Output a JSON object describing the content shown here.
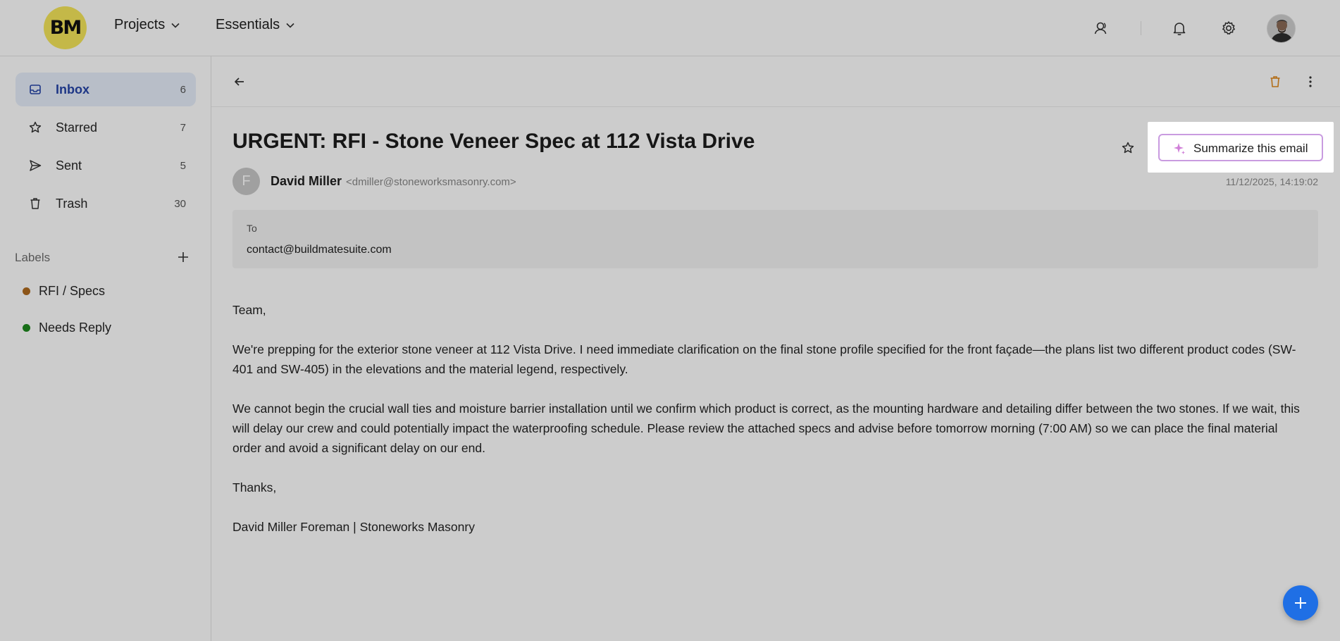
{
  "app": {
    "logo_text": "BM"
  },
  "header": {
    "menus": [
      {
        "label": "Projects"
      },
      {
        "label": "Essentials"
      }
    ],
    "icons": [
      "contacts-icon",
      "bell-icon",
      "gear-icon",
      "avatar"
    ]
  },
  "sidebar": {
    "items": [
      {
        "label": "Inbox",
        "count": "6",
        "icon": "inbox-icon",
        "active": true
      },
      {
        "label": "Starred",
        "count": "7",
        "icon": "star-icon"
      },
      {
        "label": "Sent",
        "count": "5",
        "icon": "send-icon"
      },
      {
        "label": "Trash",
        "count": "30",
        "icon": "trash-icon"
      }
    ],
    "labels_title": "Labels",
    "labels": [
      {
        "label": "RFI / Specs",
        "color": "#b06b1f"
      },
      {
        "label": "Needs Reply",
        "color": "#1e8a1e"
      }
    ]
  },
  "email": {
    "subject": "URGENT: RFI - Stone Veneer Spec at 112 Vista Drive",
    "sender_initial": "F",
    "sender_name": "David Miller",
    "sender_email": "<dmiller@stoneworksmasonry.com>",
    "timestamp": "11/12/2025, 14:19:02",
    "to_label": "To",
    "to_value": "contact@buildmatesuite.com",
    "summarize_label": "Summarize this email",
    "body": [
      "Team,",
      "We're prepping for the exterior stone veneer at 112 Vista Drive. I need immediate clarification on the final stone profile specified for the front façade—the plans list two different product codes (SW-401 and SW-405) in the elevations and the material legend, respectively.",
      "We cannot begin the crucial wall ties and moisture barrier installation until we confirm which product is correct, as the mounting hardware and detailing differ between the two stones. If we wait, this will delay our crew and could potentially impact the waterproofing schedule. Please review the attached specs and advise before tomorrow morning (7:00 AM) so we can place the final material order and avoid a significant delay on our end.",
      "Thanks,",
      "David Miller Foreman | Stoneworks Masonry"
    ]
  },
  "colors": {
    "accent": "#2544a8",
    "fab": "#1f6fe5",
    "trash_action": "#e08a1e",
    "summarize_border": "#c99be0",
    "logo_bg": "#f6e75a"
  }
}
